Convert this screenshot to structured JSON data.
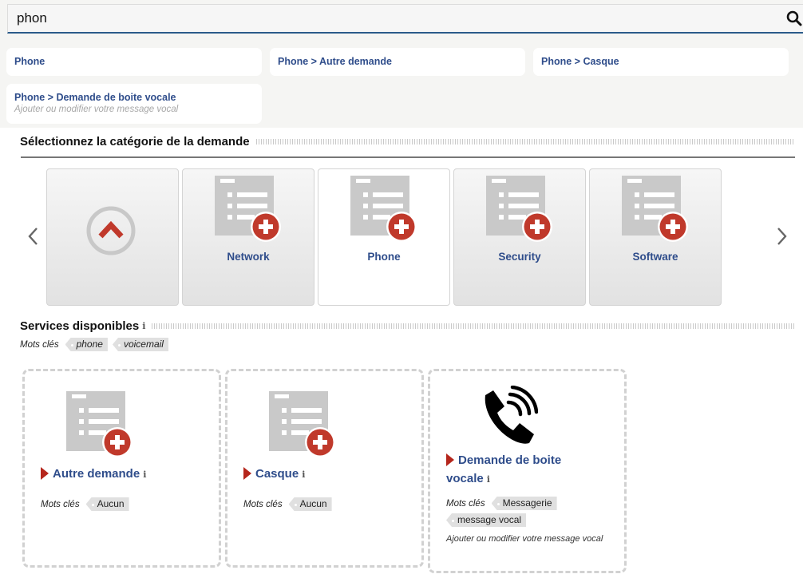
{
  "search": {
    "value": "phon"
  },
  "suggestions": [
    {
      "title": "Phone",
      "description": ""
    },
    {
      "title": "Phone > Autre demande",
      "description": ""
    },
    {
      "title": "Phone > Casque",
      "description": ""
    },
    {
      "title": "Phone > Demande de boite vocale",
      "description": "Ajouter ou modifier votre message vocal"
    }
  ],
  "category_section": {
    "title": "Sélectionnez la catégorie de la demande",
    "cards": [
      {
        "label": "",
        "icon": "chevron-up-circle-icon"
      },
      {
        "label": "Network",
        "icon": "service-list-add-icon"
      },
      {
        "label": "Phone",
        "icon": "service-list-add-icon",
        "selected": true
      },
      {
        "label": "Security",
        "icon": "service-list-add-icon"
      },
      {
        "label": "Software",
        "icon": "service-list-add-icon"
      }
    ]
  },
  "services_section": {
    "title": "Services disponibles",
    "info": "i",
    "keywords_label": "Mots clés",
    "keywords": [
      "phone",
      "voicemail"
    ]
  },
  "services": [
    {
      "title": "Autre demande",
      "info": "i",
      "keywords_label": "Mots clés",
      "keywords": [
        "Aucun"
      ],
      "description": "",
      "icon": "service-list-add-icon"
    },
    {
      "title": "Casque",
      "info": "i",
      "keywords_label": "Mots clés",
      "keywords": [
        "Aucun"
      ],
      "description": "",
      "icon": "service-list-add-icon"
    },
    {
      "title_line1": "Demande de boite",
      "title_line2": "vocale",
      "info": "i",
      "keywords_label": "Mots clés",
      "keywords": [
        "Messagerie",
        "message vocal"
      ],
      "description": "Ajouter ou modifier votre message vocal",
      "icon": "phone-ringing-icon"
    }
  ],
  "colors": {
    "accent": "#2f4d8b",
    "red": "#c0392b",
    "search_underline": "#2b5b8a"
  }
}
